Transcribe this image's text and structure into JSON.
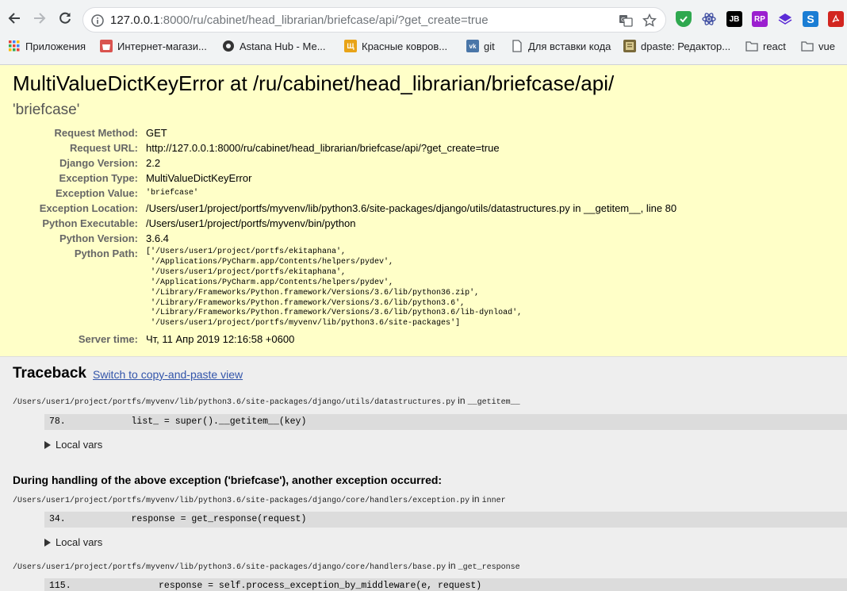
{
  "browser": {
    "url_host": "127.0.0.1",
    "url_rest": ":8000/ru/cabinet/head_librarian/briefcase/api/?get_create=true",
    "extensions": [
      {
        "name": "shield-extension",
        "label": "",
        "color": "#2fa84f"
      },
      {
        "name": "react-devtools-extension",
        "label": "⚛",
        "color": "#ffffff"
      },
      {
        "name": "jetbrains-extension",
        "label": "JB",
        "color": "#000000"
      },
      {
        "name": "rp-extension",
        "label": "RP",
        "color": "#9b1fcf"
      },
      {
        "name": "layers-extension",
        "label": "",
        "color": "#5b2bd6"
      },
      {
        "name": "s-extension",
        "label": "S",
        "color": "#1a7dd4"
      },
      {
        "name": "pdf-extension",
        "label": "⤓",
        "color": "#d2251f"
      }
    ]
  },
  "bookmarks": [
    {
      "label": "Приложения",
      "icon": "apps-grid-icon"
    },
    {
      "label": "Интернет-магази...",
      "icon": "shop-icon"
    },
    {
      "label": "Astana Hub - Ме...",
      "icon": "astana-hub-icon"
    },
    {
      "label": "Красные ковров...",
      "icon": "carpet-icon"
    },
    {
      "label": "git",
      "icon": "vk-icon"
    },
    {
      "label": "Для вставки кода",
      "icon": "page-icon"
    },
    {
      "label": "dpaste: Редактор...",
      "icon": "dpaste-icon"
    },
    {
      "label": "react",
      "icon": "folder-icon"
    },
    {
      "label": "vue",
      "icon": "folder-icon"
    }
  ],
  "error": {
    "title": "MultiValueDictKeyError at /ru/cabinet/head_librarian/briefcase/api/",
    "value": "'briefcase'"
  },
  "meta": [
    {
      "key": "Request Method:",
      "value": "GET"
    },
    {
      "key": "Request URL:",
      "value": "http://127.0.0.1:8000/ru/cabinet/head_librarian/briefcase/api/?get_create=true"
    },
    {
      "key": "Django Version:",
      "value": "2.2"
    },
    {
      "key": "Exception Type:",
      "value": "MultiValueDictKeyError"
    },
    {
      "key": "Exception Value:",
      "value": "'briefcase'"
    },
    {
      "key": "Exception Location:",
      "value": "/Users/user1/project/portfs/myvenv/lib/python3.6/site-packages/django/utils/datastructures.py in __getitem__, line 80"
    },
    {
      "key": "Python Executable:",
      "value": "/Users/user1/project/portfs/myvenv/bin/python"
    },
    {
      "key": "Python Version:",
      "value": "3.6.4"
    }
  ],
  "python_path": {
    "key": "Python Path:",
    "value": "['/Users/user1/project/portfs/ekitaphana',\n '/Applications/PyCharm.app/Contents/helpers/pydev',\n '/Users/user1/project/portfs/ekitaphana',\n '/Applications/PyCharm.app/Contents/helpers/pydev',\n '/Library/Frameworks/Python.framework/Versions/3.6/lib/python36.zip',\n '/Library/Frameworks/Python.framework/Versions/3.6/lib/python3.6',\n '/Library/Frameworks/Python.framework/Versions/3.6/lib/python3.6/lib-dynload',\n '/Users/user1/project/portfs/myvenv/lib/python3.6/site-packages']"
  },
  "server_time": {
    "key": "Server time:",
    "value": "Чт, 11 Апр 2019 12:16:58 +0600"
  },
  "traceback": {
    "title": "Traceback",
    "switch_link": "Switch to copy-and-paste view",
    "in_word": "in",
    "local_vars": "Local vars",
    "during": "During handling of the above exception ('briefcase'), another exception occurred:",
    "frames": [
      {
        "path": "/Users/user1/project/portfs/myvenv/lib/python3.6/site-packages/django/utils/datastructures.py",
        "func": "__getitem__",
        "code": "78.            list_ = super().__getitem__(key)"
      },
      {
        "path": "/Users/user1/project/portfs/myvenv/lib/python3.6/site-packages/django/core/handlers/exception.py",
        "func": "inner",
        "code": "34.            response = get_response(request)"
      },
      {
        "path": "/Users/user1/project/portfs/myvenv/lib/python3.6/site-packages/django/core/handlers/base.py",
        "func": "_get_response",
        "code": "115.                response = self.process_exception_by_middleware(e, request)"
      }
    ]
  }
}
